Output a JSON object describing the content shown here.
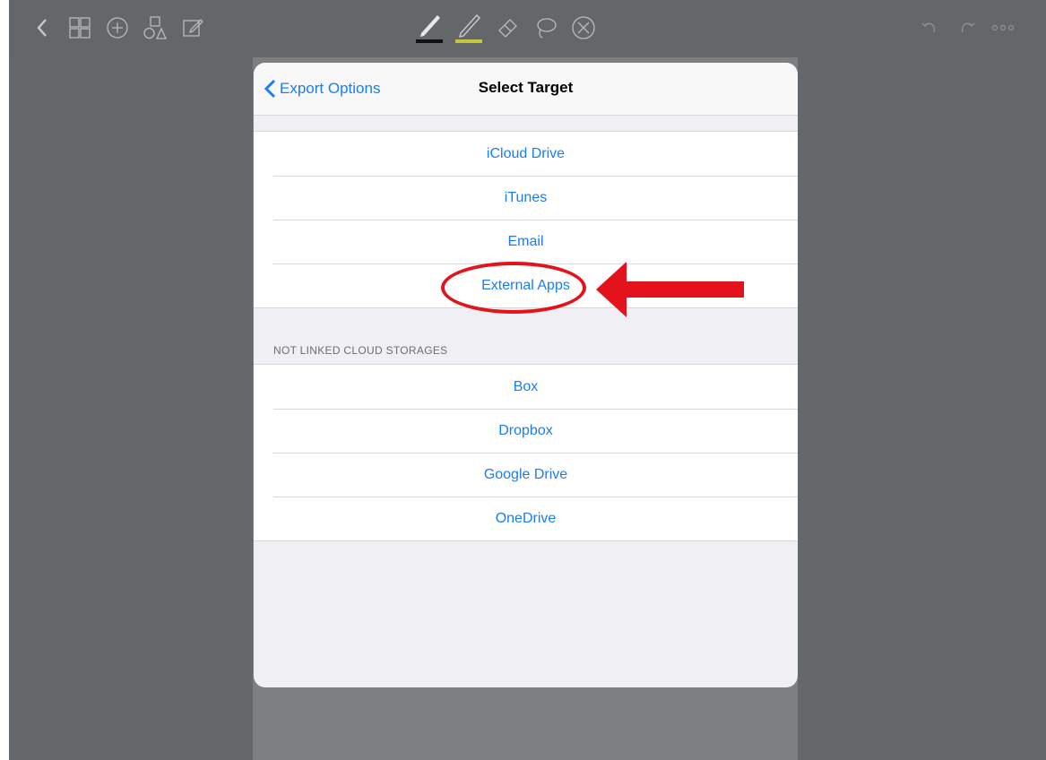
{
  "toolbar": {
    "left_icons": [
      "chevron-left-icon",
      "grid-icon",
      "add-circle-icon",
      "shapes-icon",
      "edit-note-icon"
    ],
    "center_icons": [
      "pen-tool-icon",
      "highlighter-tool-icon",
      "eraser-tool-icon",
      "lasso-tool-icon",
      "close-circle-icon"
    ],
    "right_icons": [
      "undo-icon",
      "redo-icon",
      "more-icon"
    ]
  },
  "dialog": {
    "back_label": "Export Options",
    "title": "Select Target",
    "targets": [
      {
        "label": "iCloud Drive"
      },
      {
        "label": "iTunes"
      },
      {
        "label": "Email"
      },
      {
        "label": "External Apps"
      }
    ],
    "storage_header": "NOT LINKED CLOUD STORAGES",
    "storages": [
      {
        "label": "Box"
      },
      {
        "label": "Dropbox"
      },
      {
        "label": "Google Drive"
      },
      {
        "label": "OneDrive"
      }
    ]
  },
  "colors": {
    "accent": "#1a7ef0",
    "annotation": "#e3121b"
  }
}
